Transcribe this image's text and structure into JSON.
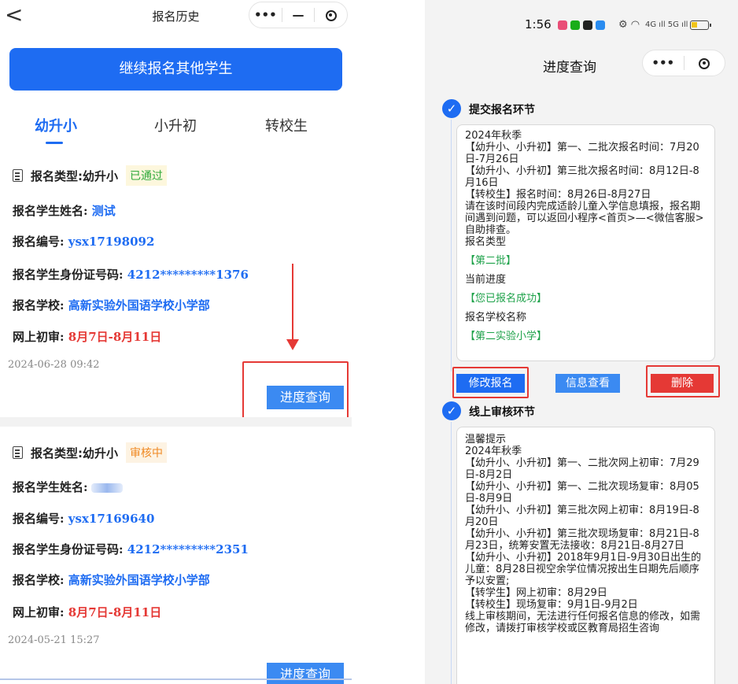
{
  "left": {
    "nav": {
      "back": "<",
      "title": "报名历史",
      "more": "•••",
      "minimize": "—"
    },
    "continue_label": "继续报名其他学生",
    "tabs": [
      "幼升小",
      "小升初",
      "转校生"
    ],
    "cards": [
      {
        "type_label": "报名类型:",
        "type_value": "幼升小",
        "status": "已通过",
        "name_label": "报名学生姓名:",
        "name_value": "测试",
        "id_label": "报名编号:",
        "id_value": "ysx17198092",
        "idcard_label": "报名学生身份证号码:",
        "idcard_value": "4212*********1376",
        "school_label": "报名学校:",
        "school_value": "高新实验外国语学校小学部",
        "review_label": "网上初审:",
        "review_value": "8月7日-8月11日",
        "timestamp": "2024-06-28 09:42",
        "button": "进度查询"
      },
      {
        "type_label": "报名类型:",
        "type_value": "幼升小",
        "status": "审核中",
        "name_label": "报名学生姓名:",
        "id_label": "报名编号:",
        "id_value": "ysx17169640",
        "idcard_label": "报名学生身份证号码:",
        "idcard_value": "4212*********2351",
        "school_label": "报名学校:",
        "school_value": "高新实验外国语学校小学部",
        "review_label": "网上初审:",
        "review_value": "8月7日-8月11日",
        "timestamp": "2024-05-21 15:27",
        "button": "进度查询"
      }
    ]
  },
  "right": {
    "status_bar": {
      "time": "1:56",
      "signal": "4G ıll 5G ıll"
    },
    "nav": {
      "title": "进度查询",
      "more": "•••"
    },
    "step1": {
      "title": "提交报名环节",
      "lines": [
        "2024年秋季",
        "【幼升小、小升初】第一、二批次报名时间：7月20日-7月26日",
        "【幼升小、小升初】第三批次报名时间：8月12日-8月16日",
        "【转校生】报名时间：8月26日-8月27日",
        "请在该时间段内完成适龄儿童入学信息填报，报名期间遇到问题，可以返回小程序<首页>—<微信客服>自助排查。"
      ],
      "type_label": "报名类型",
      "type_value": "【第二批】",
      "progress_label": "当前进度",
      "progress_value": "【您已报名成功】",
      "school_label": "报名学校名称",
      "school_value": "【第二实验小学】",
      "buttons": {
        "modify": "修改报名",
        "view": "信息查看",
        "delete": "删除"
      }
    },
    "step2": {
      "title": "线上审核环节",
      "lines": [
        "温馨提示",
        "2024年秋季",
        "【幼升小、小升初】第一、二批次网上初审：7月29日-8月2日",
        "【幼升小、小升初】第一、二批次现场复审：8月05日-8月9日",
        "【幼升小、小升初】第三批次网上初审：8月19日-8月20日",
        "【幼升小、小升初】第三批次现场复审：8月21日-8月23日，统筹安置无法接收：8月21日-8月27日",
        "【幼升小、小升初】2018年9月1日-9月30日出生的儿童：8月28日视空余学位情况按出生日期先后顺序予以安置;",
        "【转学生】网上初审：8月29日",
        "【转校生】现场复审：9月1日-9月2日",
        "线上审核期间，无法进行任何报名信息的修改，如需修改，请拨打审核学校或区教育局招生咨询"
      ]
    },
    "colors": {
      "primary": "#1e6cf2",
      "danger": "#e53935",
      "success": "#1ea24a"
    }
  }
}
